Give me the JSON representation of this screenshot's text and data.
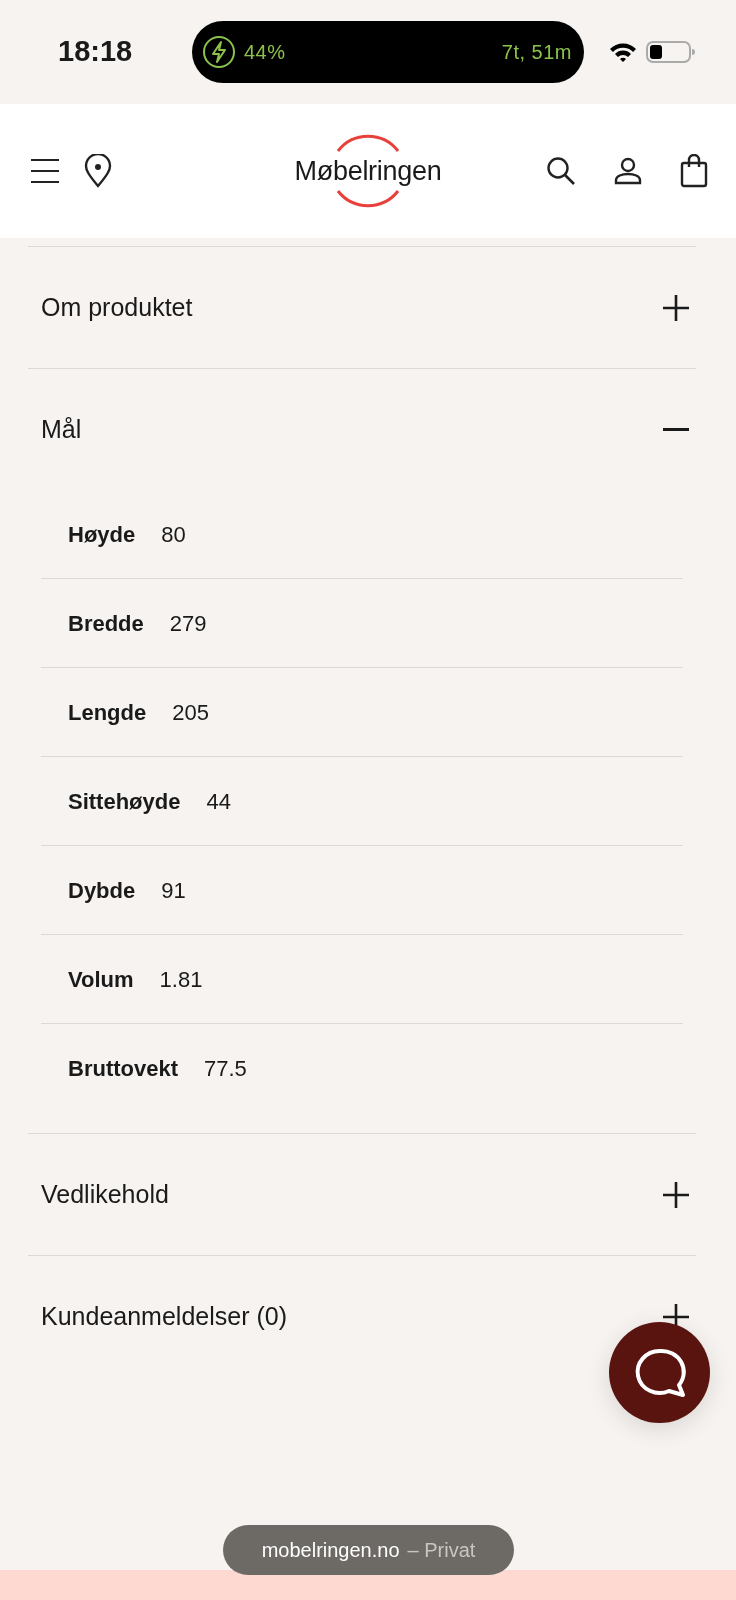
{
  "status_bar": {
    "time": "18:18",
    "battery_percent": "44%",
    "time_remaining": "7t, 51m"
  },
  "header": {
    "logo": "Møbelringen"
  },
  "sections": [
    {
      "title": "Om produktet",
      "expanded": false
    },
    {
      "title": "Mål",
      "expanded": true,
      "specs": [
        {
          "label": "Høyde",
          "value": "80"
        },
        {
          "label": "Bredde",
          "value": "279"
        },
        {
          "label": "Lengde",
          "value": "205"
        },
        {
          "label": "Sittehøyde",
          "value": "44"
        },
        {
          "label": "Dybde",
          "value": "91"
        },
        {
          "label": "Volum",
          "value": "1.81"
        },
        {
          "label": "Bruttovekt",
          "value": "77.5"
        }
      ]
    },
    {
      "title": "Vedlikehold",
      "expanded": false
    },
    {
      "title": "Kundeanmeldelser (0)",
      "expanded": false
    }
  ],
  "browser": {
    "domain": "mobelringen.no",
    "mode": "– Privat"
  }
}
